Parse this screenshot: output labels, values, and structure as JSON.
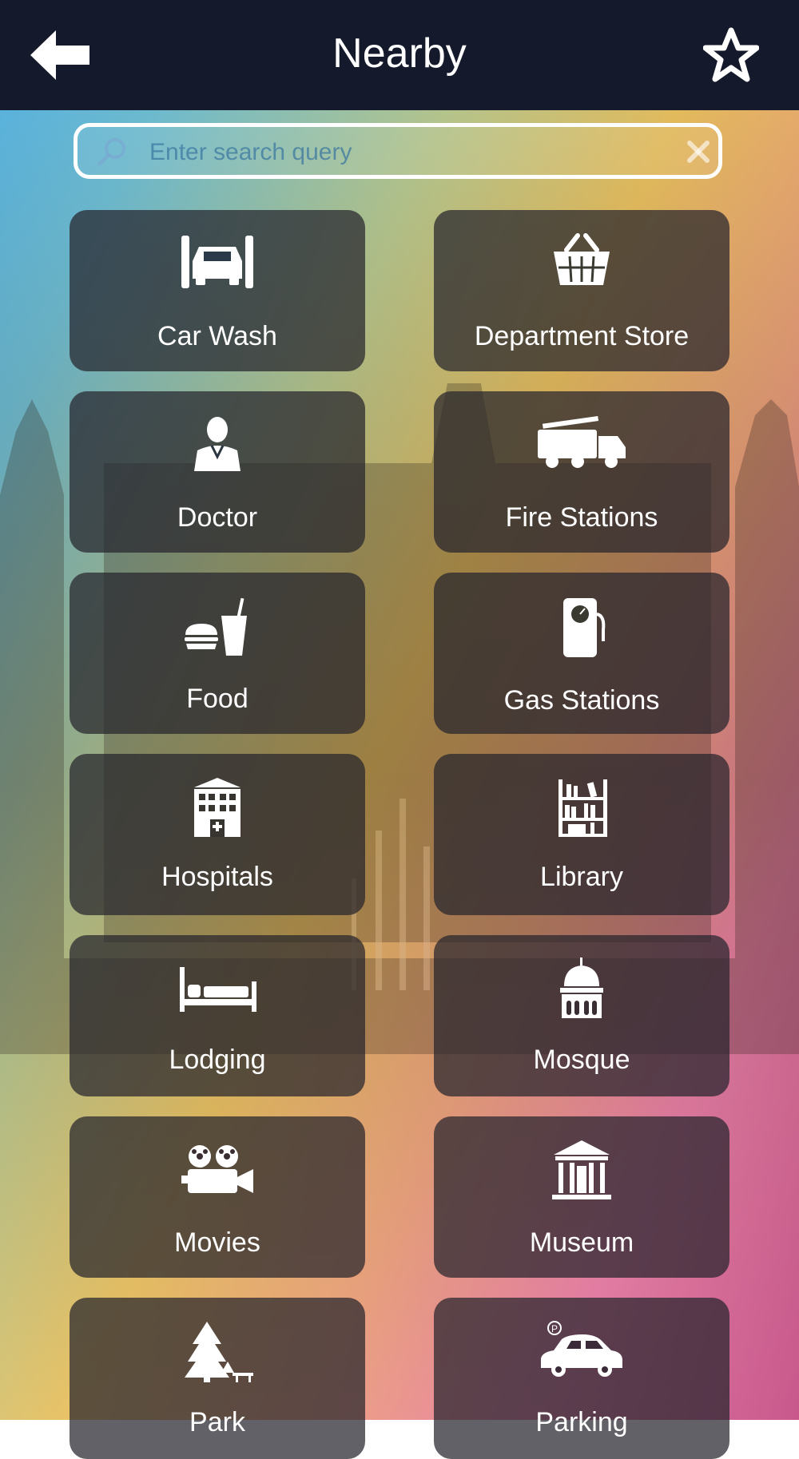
{
  "header": {
    "title": "Nearby",
    "back_icon": "arrow-left-icon",
    "favorite_icon": "star-outline-icon"
  },
  "search": {
    "placeholder": "Enter search query",
    "value": "",
    "search_icon": "magnifier-icon",
    "clear_icon": "close-icon"
  },
  "categories": [
    {
      "label": "Car Wash",
      "icon": "car-wash-icon"
    },
    {
      "label": "Department Store",
      "icon": "shopping-basket-icon"
    },
    {
      "label": "Doctor",
      "icon": "doctor-icon"
    },
    {
      "label": "Fire Stations",
      "icon": "fire-truck-icon"
    },
    {
      "label": "Food",
      "icon": "fast-food-icon"
    },
    {
      "label": "Gas Stations",
      "icon": "fuel-pump-icon"
    },
    {
      "label": "Hospitals",
      "icon": "hospital-building-icon"
    },
    {
      "label": "Library",
      "icon": "bookshelf-icon"
    },
    {
      "label": "Lodging",
      "icon": "bed-icon"
    },
    {
      "label": "Mosque",
      "icon": "mosque-icon"
    },
    {
      "label": "Movies",
      "icon": "movie-camera-icon"
    },
    {
      "label": "Museum",
      "icon": "museum-icon"
    },
    {
      "label": "Park",
      "icon": "park-trees-icon"
    },
    {
      "label": "Parking",
      "icon": "parking-car-icon"
    }
  ],
  "colors": {
    "topbar": "#141a2c",
    "tile": "rgba(38,36,44,0.72)",
    "text": "#ffffff"
  }
}
